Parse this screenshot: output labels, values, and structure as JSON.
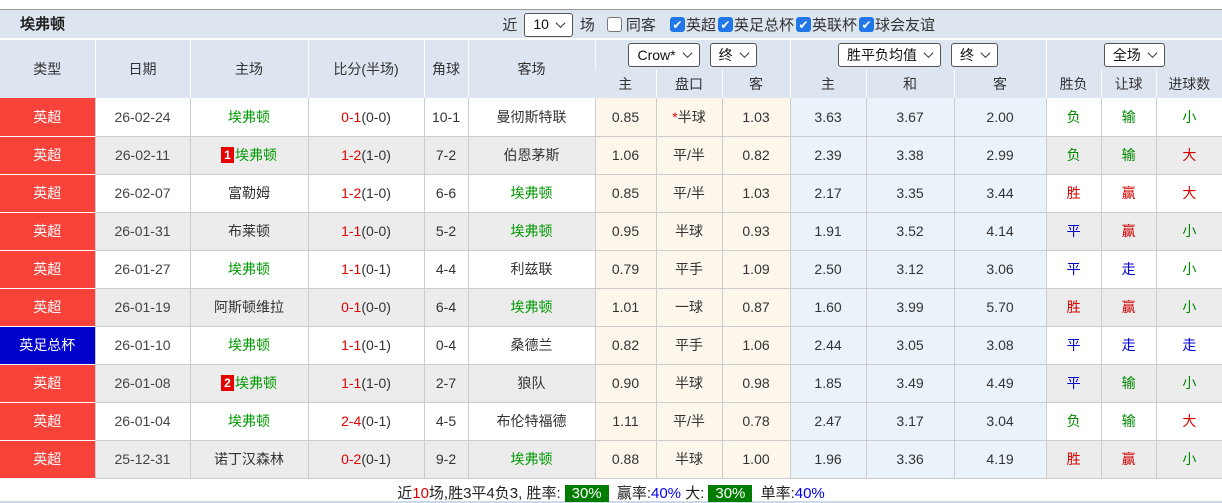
{
  "title": "埃弗顿",
  "toolbar": {
    "near_label": "近",
    "games_select": "10",
    "games_label": "场",
    "same_away_label": "同客",
    "same_away_checked": false,
    "leagues": [
      {
        "label": "英超",
        "checked": true
      },
      {
        "label": "英足总杯",
        "checked": true
      },
      {
        "label": "英联杯",
        "checked": true
      },
      {
        "label": "球会友谊",
        "checked": true
      }
    ]
  },
  "header": {
    "col_type": "类型",
    "col_date": "日期",
    "col_home": "主场",
    "col_score": "比分(半场)",
    "col_corner": "角球",
    "col_away": "客场",
    "odds_company_select": "Crow*",
    "odds_time_select": "终",
    "avg_select": "胜平负均值",
    "avg_time_select": "终",
    "scope_select": "全场",
    "sub_odds_home": "主",
    "sub_handicap": "盘口",
    "sub_odds_away": "客",
    "sub_avg_home": "主",
    "sub_avg_draw": "和",
    "sub_avg_away": "客",
    "sub_result": "胜负",
    "sub_handicap_result": "让球",
    "sub_goals": "进球数"
  },
  "colors": {
    "league_colors": {
      "英超": "#f9423a",
      "英足总杯": "#0000cd"
    },
    "result_colors": {
      "胜": "#d40000",
      "负": "#008800",
      "平": "#0000cc",
      "赢": "#d40000",
      "输": "#008800",
      "走": "#0000cc",
      "大": "#d40000",
      "小": "#008800"
    },
    "team_highlight": "#009900",
    "score_red": "#e00000",
    "badge_green": "#007d00"
  },
  "table": {
    "rows": [
      {
        "league": "英超",
        "date": "26-02-24",
        "home": "埃弗顿",
        "home_badge": "",
        "score": "0-1",
        "half": "(0-0)",
        "corner": "10-1",
        "away": "曼彻斯特联",
        "odds_home": "0.85",
        "handicap": "半球",
        "handicap_star": true,
        "odds_away": "1.03",
        "avg_home": "3.63",
        "avg_draw": "3.67",
        "avg_away": "2.00",
        "result": "负",
        "handicap_result": "输",
        "goals_result": "小"
      },
      {
        "league": "英超",
        "date": "26-02-11",
        "home": "埃弗顿",
        "home_badge": "1",
        "score": "1-2",
        "half": "(1-0)",
        "corner": "7-2",
        "away": "伯恩茅斯",
        "odds_home": "1.06",
        "handicap": "平/半",
        "handicap_star": false,
        "odds_away": "0.82",
        "avg_home": "2.39",
        "avg_draw": "3.38",
        "avg_away": "2.99",
        "result": "负",
        "handicap_result": "输",
        "goals_result": "大"
      },
      {
        "league": "英超",
        "date": "26-02-07",
        "home": "富勒姆",
        "home_badge": "",
        "score": "1-2",
        "half": "(1-0)",
        "corner": "6-6",
        "away": "埃弗顿",
        "odds_home": "0.85",
        "handicap": "平/半",
        "handicap_star": false,
        "odds_away": "1.03",
        "avg_home": "2.17",
        "avg_draw": "3.35",
        "avg_away": "3.44",
        "result": "胜",
        "handicap_result": "赢",
        "goals_result": "大"
      },
      {
        "league": "英超",
        "date": "26-01-31",
        "home": "布莱顿",
        "home_badge": "",
        "score": "1-1",
        "half": "(0-0)",
        "corner": "5-2",
        "away": "埃弗顿",
        "odds_home": "0.95",
        "handicap": "半球",
        "handicap_star": false,
        "odds_away": "0.93",
        "avg_home": "1.91",
        "avg_draw": "3.52",
        "avg_away": "4.14",
        "result": "平",
        "handicap_result": "赢",
        "goals_result": "小"
      },
      {
        "league": "英超",
        "date": "26-01-27",
        "home": "埃弗顿",
        "home_badge": "",
        "score": "1-1",
        "half": "(0-1)",
        "corner": "4-4",
        "away": "利兹联",
        "odds_home": "0.79",
        "handicap": "平手",
        "handicap_star": false,
        "odds_away": "1.09",
        "avg_home": "2.50",
        "avg_draw": "3.12",
        "avg_away": "3.06",
        "result": "平",
        "handicap_result": "走",
        "goals_result": "小"
      },
      {
        "league": "英超",
        "date": "26-01-19",
        "home": "阿斯顿维拉",
        "home_badge": "",
        "score": "0-1",
        "half": "(0-0)",
        "corner": "6-4",
        "away": "埃弗顿",
        "odds_home": "1.01",
        "handicap": "一球",
        "handicap_star": false,
        "odds_away": "0.87",
        "avg_home": "1.60",
        "avg_draw": "3.99",
        "avg_away": "5.70",
        "result": "胜",
        "handicap_result": "赢",
        "goals_result": "小"
      },
      {
        "league": "英足总杯",
        "date": "26-01-10",
        "home": "埃弗顿",
        "home_badge": "",
        "score": "1-1",
        "half": "(0-1)",
        "corner": "0-4",
        "away": "桑德兰",
        "odds_home": "0.82",
        "handicap": "平手",
        "handicap_star": false,
        "odds_away": "1.06",
        "avg_home": "2.44",
        "avg_draw": "3.05",
        "avg_away": "3.08",
        "result": "平",
        "handicap_result": "走",
        "goals_result": "走"
      },
      {
        "league": "英超",
        "date": "26-01-08",
        "home": "埃弗顿",
        "home_badge": "2",
        "score": "1-1",
        "half": "(1-0)",
        "corner": "2-7",
        "away": "狼队",
        "odds_home": "0.90",
        "handicap": "半球",
        "handicap_star": false,
        "odds_away": "0.98",
        "avg_home": "1.85",
        "avg_draw": "3.49",
        "avg_away": "4.49",
        "result": "平",
        "handicap_result": "输",
        "goals_result": "小"
      },
      {
        "league": "英超",
        "date": "26-01-04",
        "home": "埃弗顿",
        "home_badge": "",
        "score": "2-4",
        "half": "(0-1)",
        "corner": "4-5",
        "away": "布伦特福德",
        "odds_home": "1.11",
        "handicap": "平/半",
        "handicap_star": false,
        "odds_away": "0.78",
        "avg_home": "2.47",
        "avg_draw": "3.17",
        "avg_away": "3.04",
        "result": "负",
        "handicap_result": "输",
        "goals_result": "大"
      },
      {
        "league": "英超",
        "date": "25-12-31",
        "home": "诺丁汉森林",
        "home_badge": "",
        "score": "0-2",
        "half": "(0-1)",
        "corner": "9-2",
        "away": "埃弗顿",
        "odds_home": "0.88",
        "handicap": "半球",
        "handicap_star": false,
        "odds_away": "1.00",
        "avg_home": "1.96",
        "avg_draw": "3.36",
        "avg_away": "4.19",
        "result": "胜",
        "handicap_result": "赢",
        "goals_result": "小"
      }
    ]
  },
  "footer": {
    "near": "近",
    "count": "10",
    "summary": "场,胜3平4负3, 胜率:",
    "win_rate": "30%",
    "win_label": "赢率:",
    "win_pct": "40%",
    "big_label": "大:",
    "big_rate": "30%",
    "single_label": "单率:",
    "single_pct": "40%"
  }
}
